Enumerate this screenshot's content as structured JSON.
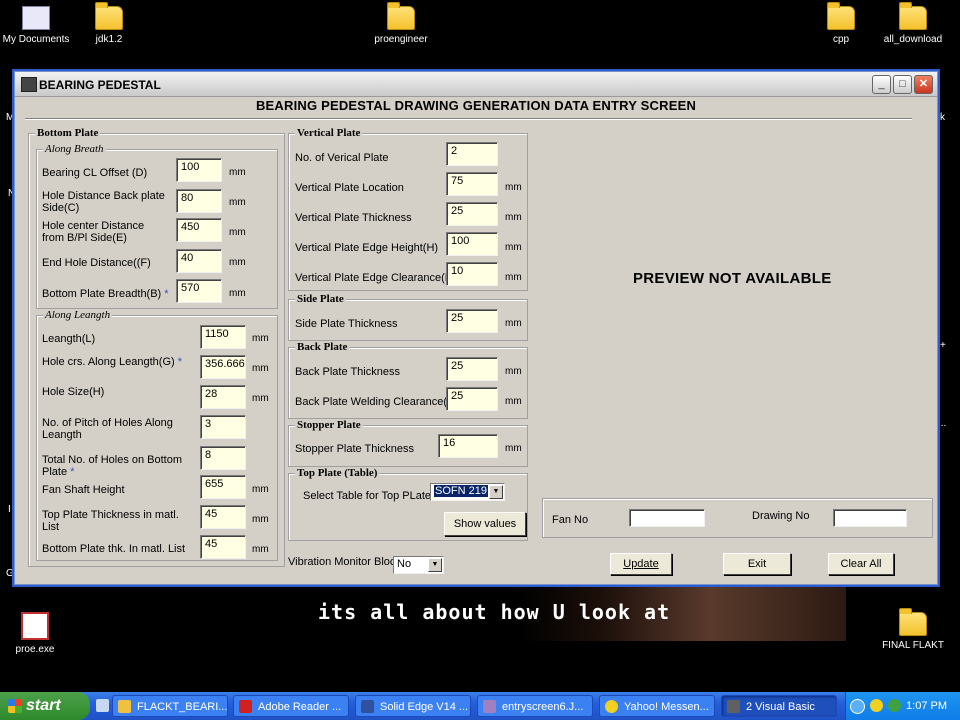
{
  "desktop": {
    "icons": [
      {
        "label": "My Documents"
      },
      {
        "label": "jdk1.2"
      },
      {
        "label": "proengineer"
      },
      {
        "label": "cpp"
      },
      {
        "label": "all_download"
      },
      {
        "label": "proe.exe"
      },
      {
        "label": "FINAL FLAKT"
      }
    ],
    "edge_left": [
      "M",
      "N",
      "I",
      "G"
    ],
    "edge_right": [
      "k",
      "+",
      "..."
    ],
    "banner_text": "its all about how  U  look at"
  },
  "window": {
    "title": "BEARING PEDESTAL",
    "heading": "BEARING PEDESTAL DRAWING GENERATION  DATA ENTRY SCREEN",
    "controls": {
      "minimize": "_",
      "maximize": "□",
      "close": "✕"
    },
    "preview_text": "PREVIEW NOT AVAILABLE",
    "bottom_plate": {
      "title": "Bottom Plate",
      "along_breath": {
        "title": "Along Breath",
        "fields": [
          {
            "label": "Bearing CL Offset (D)",
            "value": "100",
            "unit": "mm"
          },
          {
            "label": "Hole Distance Back plate Side(C)",
            "value": "80",
            "unit": "mm"
          },
          {
            "label": "Hole center  Distance from B/Pl Side(E)",
            "value": "450",
            "unit": "mm"
          },
          {
            "label": "End Hole Distance((F)",
            "value": "40",
            "unit": "mm"
          },
          {
            "label": "Bottom Plate Breadth(B)",
            "value": "570",
            "unit": "mm",
            "star": "*"
          }
        ]
      },
      "along_length": {
        "title": "Along Leangth",
        "fields": [
          {
            "label": "Leangth(L)",
            "value": "1150",
            "unit": "mm"
          },
          {
            "label": "Hole crs. Along Leangth(G)",
            "value": "356.666",
            "unit": "mm",
            "star": "*"
          },
          {
            "label": "Hole Size(H)",
            "value": "28",
            "unit": "mm"
          },
          {
            "label": "No. of Pitch of Holes Along Leangth",
            "value": "3",
            "unit": ""
          },
          {
            "label": "Total No. of Holes on Bottom Plate",
            "value": "8",
            "unit": "",
            "star": "*"
          },
          {
            "label": "Fan Shaft Height",
            "value": "655",
            "unit": "mm"
          },
          {
            "label": "Top Plate Thickness in matl. List",
            "value": "45",
            "unit": "mm"
          },
          {
            "label": "Bottom Plate thk. In matl. List",
            "value": "45",
            "unit": "mm"
          }
        ]
      }
    },
    "vertical_plate": {
      "title": "Vertical Plate",
      "fields": [
        {
          "label": "No. of Verical Plate",
          "value": "2",
          "unit": ""
        },
        {
          "label": "Vertical Plate Location",
          "value": "75",
          "unit": "mm"
        },
        {
          "label": "Vertical Plate Thickness",
          "value": "25",
          "unit": "mm"
        },
        {
          "label": "Vertical Plate Edge Height(H)",
          "value": "100",
          "unit": "mm"
        },
        {
          "label": "Vertical Plate Edge Clearance(L)",
          "value": "10",
          "unit": "mm"
        }
      ]
    },
    "side_plate": {
      "title": "Side Plate",
      "label": "Side Plate Thickness",
      "value": "25",
      "unit": "mm"
    },
    "back_plate": {
      "title": "Back Plate",
      "fields": [
        {
          "label": "Back Plate Thickness",
          "value": "25",
          "unit": "mm"
        },
        {
          "label": "Back Plate Welding Clearance(A)",
          "value": "25",
          "unit": "mm"
        }
      ]
    },
    "stopper_plate": {
      "title": "Stopper Plate",
      "label": "Stopper Plate Thickness",
      "value": "16",
      "unit": "mm"
    },
    "top_plate": {
      "title": "Top Plate (Table)",
      "label": "Select Table for Top PLate",
      "selected": "SOFN 219",
      "show_values": "Show values"
    },
    "vibration": {
      "label": "Vibration Monitor Block",
      "selected": "No"
    },
    "fan_no": {
      "label": "Fan No",
      "value": ""
    },
    "drawing_no": {
      "label": "Drawing No",
      "value": ""
    },
    "buttons": {
      "update": "Update",
      "exit": "Exit",
      "clear_all": "Clear All"
    }
  },
  "taskbar": {
    "start": "start",
    "tasks": [
      {
        "label": "FLACKT_BEARI...",
        "color": "#f0c040"
      },
      {
        "label": "Adobe Reader ...",
        "color": "#d02020"
      },
      {
        "label": "Solid Edge V14 ...",
        "color": "#3050a0"
      },
      {
        "label": "entryscreen6.J...",
        "color": "#a080c0"
      },
      {
        "label": "Yahoo! Messen...",
        "color": "#f0d020"
      },
      {
        "label": "2 Visual Basic",
        "color": "#606060"
      }
    ],
    "clock": "1:07 PM"
  }
}
